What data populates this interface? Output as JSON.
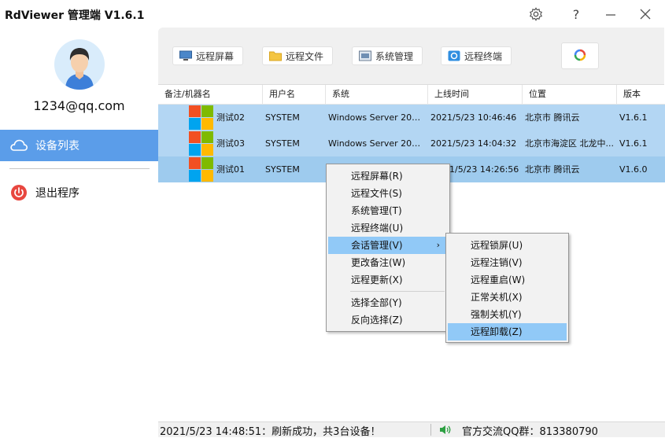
{
  "window": {
    "title": "RdViewer  管理端 V1.6.1"
  },
  "sidebar": {
    "account": "1234@qq.com",
    "items": [
      {
        "label": "设备列表",
        "icon": "cloud-icon",
        "active": true
      },
      {
        "label": "退出程序",
        "icon": "power-icon",
        "active": false
      }
    ]
  },
  "toolbar": {
    "buttons": [
      {
        "label": "远程屏幕",
        "icon": "monitor-icon"
      },
      {
        "label": "远程文件",
        "icon": "folder-icon"
      },
      {
        "label": "系统管理",
        "icon": "system-icon"
      },
      {
        "label": "远程终端",
        "icon": "terminal-icon"
      }
    ],
    "refresh_icon": "refresh-icon"
  },
  "table": {
    "columns": [
      "备注/机器名",
      "用户名",
      "系统",
      "上线时间",
      "位置",
      "版本"
    ],
    "rows": [
      {
        "name": "测试02",
        "user": "SYSTEM",
        "os": "Windows Server 2012 ...",
        "time": "2021/5/23 10:46:46",
        "location": "北京市 腾讯云",
        "version": "V1.6.1"
      },
      {
        "name": "测试03",
        "user": "SYSTEM",
        "os": "Windows Server 2016 ...",
        "time": "2021/5/23 14:04:32",
        "location": "北京市海淀区 北龙中...",
        "version": "V1.6.1"
      },
      {
        "name": "测试01",
        "user": "SYSTEM",
        "os": "",
        "time": "1/5/23 14:26:56",
        "location": "北京市 腾讯云",
        "version": "V1.6.0"
      }
    ]
  },
  "context_menu": {
    "items": [
      "远程屏幕(R)",
      "远程文件(S)",
      "系统管理(T)",
      "远程终端(U)",
      "会话管理(V)",
      "更改备注(W)",
      "远程更新(X)",
      "选择全部(Y)",
      "反向选择(Z)"
    ],
    "highlighted": "会话管理(V)"
  },
  "submenu": {
    "items": [
      "远程锁屏(U)",
      "远程注销(V)",
      "远程重启(W)",
      "正常关机(X)",
      "强制关机(Y)",
      "远程卸载(Z)"
    ],
    "highlighted": "远程卸载(Z)"
  },
  "status": {
    "message": "2021/5/23 14:48:51：刷新成功，共3台设备！",
    "qq_group": "官方交流QQ群：813380790"
  },
  "colors": {
    "accent": "#5b9de9",
    "row_selected": "#b3d6f3",
    "menu_highlight": "#91c9f7"
  }
}
